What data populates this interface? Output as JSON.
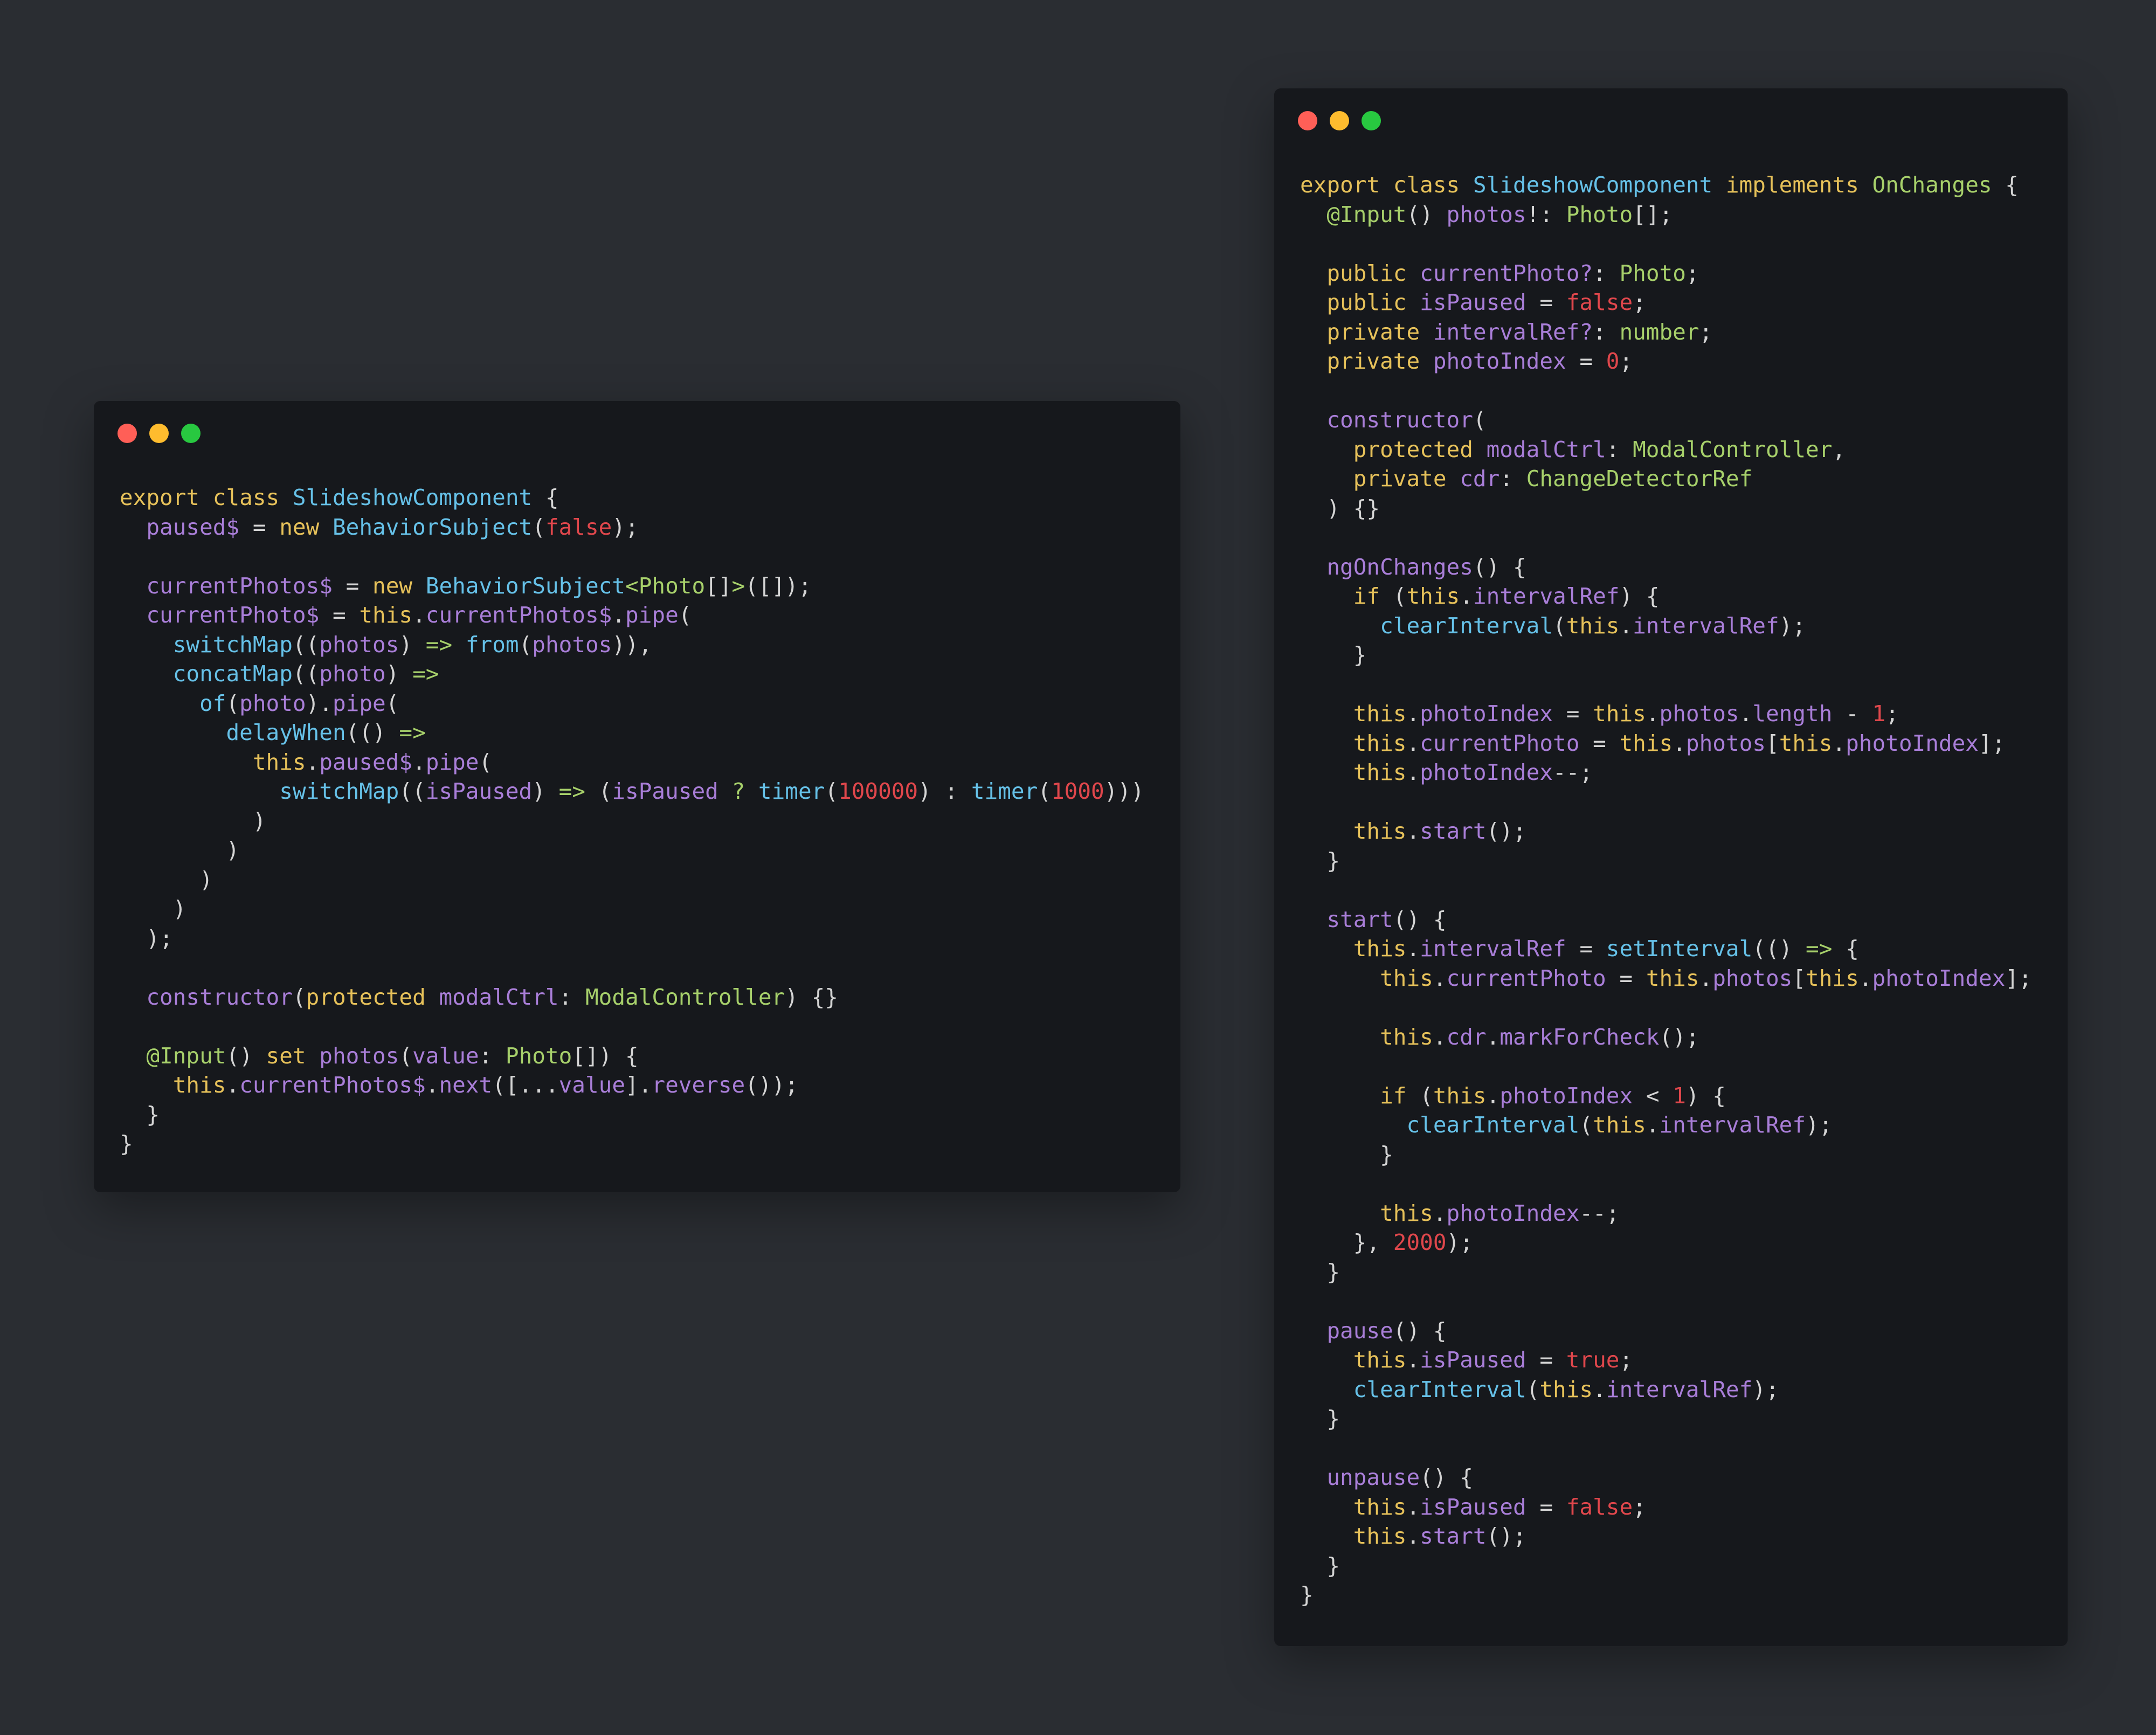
{
  "colors": {
    "background": "#2a2d32",
    "window": "#16181c",
    "keyword": "#e6c15a",
    "type_name": "#66c1e8",
    "identifier": "#a97ed8",
    "type_annotation": "#a7d06b",
    "literal": "#e0474c",
    "punctuation": "#d4d4d4",
    "traffic_red": "#ff5f57",
    "traffic_yellow": "#febc2e",
    "traffic_green": "#28c840"
  },
  "windows": [
    {
      "id": "left",
      "lines": [
        [
          [
            "k",
            "export class "
          ],
          [
            "ty",
            "SlideshowComponent"
          ],
          [
            "p",
            " {"
          ]
        ],
        [
          [
            "i",
            "  paused$"
          ],
          [
            "p",
            " = "
          ],
          [
            "k",
            "new "
          ],
          [
            "ty",
            "BehaviorSubject"
          ],
          [
            "p",
            "("
          ],
          [
            "n",
            "false"
          ],
          [
            "p",
            ");"
          ]
        ],
        [],
        [
          [
            "i",
            "  currentPhotos$"
          ],
          [
            "p",
            " = "
          ],
          [
            "k",
            "new "
          ],
          [
            "ty",
            "BehaviorSubject"
          ],
          [
            "ti",
            "<Photo"
          ],
          [
            "p",
            "[]"
          ],
          [
            "ti",
            ">"
          ],
          [
            "p",
            "([]);"
          ]
        ],
        [
          [
            "i",
            "  currentPhoto$"
          ],
          [
            "p",
            " = "
          ],
          [
            "k",
            "this"
          ],
          [
            "p",
            "."
          ],
          [
            "i",
            "currentPhotos$"
          ],
          [
            "p",
            "."
          ],
          [
            "i",
            "pipe"
          ],
          [
            "p",
            "("
          ]
        ],
        [
          [
            "f",
            "    switchMap"
          ],
          [
            "p",
            "(("
          ],
          [
            "i",
            "photos"
          ],
          [
            "p",
            ") "
          ],
          [
            "op",
            "=>"
          ],
          [
            "p",
            " "
          ],
          [
            "f",
            "from"
          ],
          [
            "p",
            "("
          ],
          [
            "i",
            "photos"
          ],
          [
            "p",
            ")),"
          ]
        ],
        [
          [
            "f",
            "    concatMap"
          ],
          [
            "p",
            "(("
          ],
          [
            "i",
            "photo"
          ],
          [
            "p",
            ") "
          ],
          [
            "op",
            "=>"
          ]
        ],
        [
          [
            "f",
            "      of"
          ],
          [
            "p",
            "("
          ],
          [
            "i",
            "photo"
          ],
          [
            "p",
            ")."
          ],
          [
            "i",
            "pipe"
          ],
          [
            "p",
            "("
          ]
        ],
        [
          [
            "f",
            "        delayWhen"
          ],
          [
            "p",
            "(() "
          ],
          [
            "op",
            "=>"
          ]
        ],
        [
          [
            "k",
            "          this"
          ],
          [
            "p",
            "."
          ],
          [
            "i",
            "paused$"
          ],
          [
            "p",
            "."
          ],
          [
            "i",
            "pipe"
          ],
          [
            "p",
            "("
          ]
        ],
        [
          [
            "f",
            "            switchMap"
          ],
          [
            "p",
            "(("
          ],
          [
            "i",
            "isPaused"
          ],
          [
            "p",
            ") "
          ],
          [
            "op",
            "=>"
          ],
          [
            "p",
            " ("
          ],
          [
            "i",
            "isPaused"
          ],
          [
            "op",
            " ? "
          ],
          [
            "f",
            "timer"
          ],
          [
            "p",
            "("
          ],
          [
            "n",
            "100000"
          ],
          [
            "p",
            ") : "
          ],
          [
            "f",
            "timer"
          ],
          [
            "p",
            "("
          ],
          [
            "n",
            "1000"
          ],
          [
            "p",
            ")))"
          ]
        ],
        [
          [
            "p",
            "          )"
          ]
        ],
        [
          [
            "p",
            "        )"
          ]
        ],
        [
          [
            "p",
            "      )"
          ]
        ],
        [
          [
            "p",
            "    )"
          ]
        ],
        [
          [
            "p",
            "  );"
          ]
        ],
        [],
        [
          [
            "i",
            "  constructor"
          ],
          [
            "p",
            "("
          ],
          [
            "k",
            "protected "
          ],
          [
            "i",
            "modalCtrl"
          ],
          [
            "p",
            ": "
          ],
          [
            "ti",
            "ModalController"
          ],
          [
            "p",
            ") {}"
          ]
        ],
        [],
        [
          [
            "ti",
            "  @Input"
          ],
          [
            "p",
            "() "
          ],
          [
            "k",
            "set "
          ],
          [
            "i",
            "photos"
          ],
          [
            "p",
            "("
          ],
          [
            "i",
            "value"
          ],
          [
            "p",
            ": "
          ],
          [
            "ti",
            "Photo"
          ],
          [
            "p",
            "[]) {"
          ]
        ],
        [
          [
            "k",
            "    this"
          ],
          [
            "p",
            "."
          ],
          [
            "i",
            "currentPhotos$"
          ],
          [
            "p",
            "."
          ],
          [
            "i",
            "next"
          ],
          [
            "p",
            "([..."
          ],
          [
            "i",
            "value"
          ],
          [
            "p",
            "]."
          ],
          [
            "i",
            "reverse"
          ],
          [
            "p",
            "());"
          ]
        ],
        [
          [
            "p",
            "  }"
          ]
        ],
        [
          [
            "p",
            "}"
          ]
        ]
      ]
    },
    {
      "id": "right",
      "lines": [
        [
          [
            "k",
            "export class "
          ],
          [
            "ty",
            "SlideshowComponent "
          ],
          [
            "k",
            "implements "
          ],
          [
            "ti",
            "OnChanges"
          ],
          [
            "p",
            " {"
          ]
        ],
        [
          [
            "ti",
            "  @Input"
          ],
          [
            "p",
            "() "
          ],
          [
            "i",
            "photos"
          ],
          [
            "p",
            "!: "
          ],
          [
            "ti",
            "Photo"
          ],
          [
            "p",
            "[];"
          ]
        ],
        [],
        [
          [
            "k",
            "  public "
          ],
          [
            "i",
            "currentPhoto?"
          ],
          [
            "p",
            ": "
          ],
          [
            "ti",
            "Photo"
          ],
          [
            "p",
            ";"
          ]
        ],
        [
          [
            "k",
            "  public "
          ],
          [
            "i",
            "isPaused"
          ],
          [
            "p",
            " = "
          ],
          [
            "n",
            "false"
          ],
          [
            "p",
            ";"
          ]
        ],
        [
          [
            "k",
            "  private "
          ],
          [
            "i",
            "intervalRef?"
          ],
          [
            "p",
            ": "
          ],
          [
            "ti",
            "number"
          ],
          [
            "p",
            ";"
          ]
        ],
        [
          [
            "k",
            "  private "
          ],
          [
            "i",
            "photoIndex"
          ],
          [
            "p",
            " = "
          ],
          [
            "n",
            "0"
          ],
          [
            "p",
            ";"
          ]
        ],
        [],
        [
          [
            "i",
            "  constructor"
          ],
          [
            "p",
            "("
          ]
        ],
        [
          [
            "k",
            "    protected "
          ],
          [
            "i",
            "modalCtrl"
          ],
          [
            "p",
            ": "
          ],
          [
            "ti",
            "ModalController"
          ],
          [
            "p",
            ","
          ]
        ],
        [
          [
            "k",
            "    private "
          ],
          [
            "i",
            "cdr"
          ],
          [
            "p",
            ": "
          ],
          [
            "ti",
            "ChangeDetectorRef"
          ]
        ],
        [
          [
            "p",
            "  ) {}"
          ]
        ],
        [],
        [
          [
            "i",
            "  ngOnChanges"
          ],
          [
            "p",
            "() {"
          ]
        ],
        [
          [
            "k",
            "    if "
          ],
          [
            "p",
            "("
          ],
          [
            "k",
            "this"
          ],
          [
            "p",
            "."
          ],
          [
            "i",
            "intervalRef"
          ],
          [
            "p",
            ") {"
          ]
        ],
        [
          [
            "f",
            "      clearInterval"
          ],
          [
            "p",
            "("
          ],
          [
            "k",
            "this"
          ],
          [
            "p",
            "."
          ],
          [
            "i",
            "intervalRef"
          ],
          [
            "p",
            ");"
          ]
        ],
        [
          [
            "p",
            "    }"
          ]
        ],
        [],
        [
          [
            "k",
            "    this"
          ],
          [
            "p",
            "."
          ],
          [
            "i",
            "photoIndex"
          ],
          [
            "p",
            " = "
          ],
          [
            "k",
            "this"
          ],
          [
            "p",
            "."
          ],
          [
            "i",
            "photos"
          ],
          [
            "p",
            "."
          ],
          [
            "i",
            "length"
          ],
          [
            "p",
            " - "
          ],
          [
            "n",
            "1"
          ],
          [
            "p",
            ";"
          ]
        ],
        [
          [
            "k",
            "    this"
          ],
          [
            "p",
            "."
          ],
          [
            "i",
            "currentPhoto"
          ],
          [
            "p",
            " = "
          ],
          [
            "k",
            "this"
          ],
          [
            "p",
            "."
          ],
          [
            "i",
            "photos"
          ],
          [
            "p",
            "["
          ],
          [
            "k",
            "this"
          ],
          [
            "p",
            "."
          ],
          [
            "i",
            "photoIndex"
          ],
          [
            "p",
            "];"
          ]
        ],
        [
          [
            "k",
            "    this"
          ],
          [
            "p",
            "."
          ],
          [
            "i",
            "photoIndex"
          ],
          [
            "p",
            "--;"
          ]
        ],
        [],
        [
          [
            "k",
            "    this"
          ],
          [
            "p",
            "."
          ],
          [
            "i",
            "start"
          ],
          [
            "p",
            "();"
          ]
        ],
        [
          [
            "p",
            "  }"
          ]
        ],
        [],
        [
          [
            "i",
            "  start"
          ],
          [
            "p",
            "() {"
          ]
        ],
        [
          [
            "k",
            "    this"
          ],
          [
            "p",
            "."
          ],
          [
            "i",
            "intervalRef"
          ],
          [
            "p",
            " = "
          ],
          [
            "f",
            "setInterval"
          ],
          [
            "p",
            "(() "
          ],
          [
            "op",
            "=>"
          ],
          [
            "p",
            " {"
          ]
        ],
        [
          [
            "k",
            "      this"
          ],
          [
            "p",
            "."
          ],
          [
            "i",
            "currentPhoto"
          ],
          [
            "p",
            " = "
          ],
          [
            "k",
            "this"
          ],
          [
            "p",
            "."
          ],
          [
            "i",
            "photos"
          ],
          [
            "p",
            "["
          ],
          [
            "k",
            "this"
          ],
          [
            "p",
            "."
          ],
          [
            "i",
            "photoIndex"
          ],
          [
            "p",
            "];"
          ]
        ],
        [],
        [
          [
            "k",
            "      this"
          ],
          [
            "p",
            "."
          ],
          [
            "i",
            "cdr"
          ],
          [
            "p",
            "."
          ],
          [
            "i",
            "markForCheck"
          ],
          [
            "p",
            "();"
          ]
        ],
        [],
        [
          [
            "k",
            "      if "
          ],
          [
            "p",
            "("
          ],
          [
            "k",
            "this"
          ],
          [
            "p",
            "."
          ],
          [
            "i",
            "photoIndex"
          ],
          [
            "p",
            " < "
          ],
          [
            "n",
            "1"
          ],
          [
            "p",
            ") {"
          ]
        ],
        [
          [
            "f",
            "        clearInterval"
          ],
          [
            "p",
            "("
          ],
          [
            "k",
            "this"
          ],
          [
            "p",
            "."
          ],
          [
            "i",
            "intervalRef"
          ],
          [
            "p",
            ");"
          ]
        ],
        [
          [
            "p",
            "      }"
          ]
        ],
        [],
        [
          [
            "k",
            "      this"
          ],
          [
            "p",
            "."
          ],
          [
            "i",
            "photoIndex"
          ],
          [
            "p",
            "--;"
          ]
        ],
        [
          [
            "p",
            "    }, "
          ],
          [
            "n",
            "2000"
          ],
          [
            "p",
            ");"
          ]
        ],
        [
          [
            "p",
            "  }"
          ]
        ],
        [],
        [
          [
            "i",
            "  pause"
          ],
          [
            "p",
            "() {"
          ]
        ],
        [
          [
            "k",
            "    this"
          ],
          [
            "p",
            "."
          ],
          [
            "i",
            "isPaused"
          ],
          [
            "p",
            " = "
          ],
          [
            "n",
            "true"
          ],
          [
            "p",
            ";"
          ]
        ],
        [
          [
            "f",
            "    clearInterval"
          ],
          [
            "p",
            "("
          ],
          [
            "k",
            "this"
          ],
          [
            "p",
            "."
          ],
          [
            "i",
            "intervalRef"
          ],
          [
            "p",
            ");"
          ]
        ],
        [
          [
            "p",
            "  }"
          ]
        ],
        [],
        [
          [
            "i",
            "  unpause"
          ],
          [
            "p",
            "() {"
          ]
        ],
        [
          [
            "k",
            "    this"
          ],
          [
            "p",
            "."
          ],
          [
            "i",
            "isPaused"
          ],
          [
            "p",
            " = "
          ],
          [
            "n",
            "false"
          ],
          [
            "p",
            ";"
          ]
        ],
        [
          [
            "k",
            "    this"
          ],
          [
            "p",
            "."
          ],
          [
            "i",
            "start"
          ],
          [
            "p",
            "();"
          ]
        ],
        [
          [
            "p",
            "  }"
          ]
        ],
        [
          [
            "p",
            "}"
          ]
        ]
      ]
    }
  ]
}
